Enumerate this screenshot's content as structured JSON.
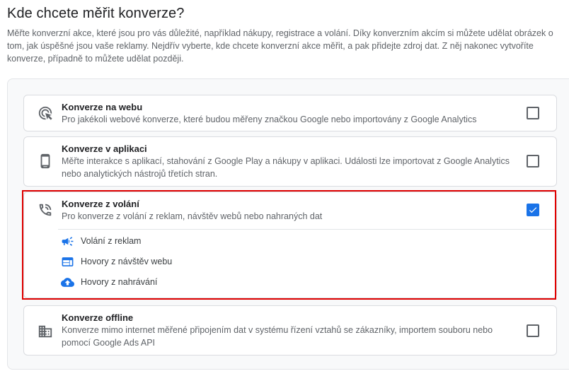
{
  "page": {
    "title": "Kde chcete měřit konverze?",
    "description": "Měřte konverzní akce, které jsou pro vás důležité, například nákupy, registrace a volání. Díky konverzním akcím si můžete udělat obrázek o tom, jak úspěšné jsou vaše reklamy. Nejdřív vyberte, kde chcete konverzní akce měřit, a pak přidejte zdroj dat. Z něj nakonec vytvoříte konverze, případně to můžete udělat později."
  },
  "options": [
    {
      "title": "Konverze na webu",
      "description": "Pro jakékoli webové konverze, které budou měřeny značkou Google nebo importovány z Google Analytics",
      "icon": "cursor-click-icon",
      "checked": false
    },
    {
      "title": "Konverze v aplikaci",
      "description": "Měřte interakce s aplikací, stahování z Google Play a nákupy v aplikaci. Události lze importovat z Google Analytics nebo analytických nástrojů třetích stran.",
      "icon": "phone-device-icon",
      "checked": false
    },
    {
      "title": "Konverze z volání",
      "description": "Pro konverze z volání z reklam, návštěv webů nebo nahraných dat",
      "icon": "phone-call-icon",
      "checked": true,
      "sub_items": [
        {
          "label": "Volání z reklam",
          "icon": "megaphone-icon"
        },
        {
          "label": "Hovory z návštěv webu",
          "icon": "web-icon"
        },
        {
          "label": "Hovory z nahrávání",
          "icon": "cloud-upload-icon"
        }
      ]
    },
    {
      "title": "Konverze offline",
      "description": "Konverze mimo internet měřené připojením dat v systému řízení vztahů se zákazníky, importem souboru nebo pomocí Google Ads API",
      "icon": "building-icon",
      "checked": false
    }
  ],
  "colors": {
    "accent": "#1a73e8",
    "highlight": "#e00000",
    "text_secondary": "#5f6368"
  }
}
